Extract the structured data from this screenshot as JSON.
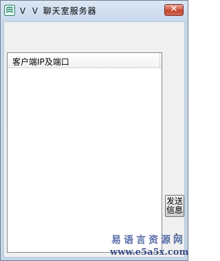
{
  "window": {
    "title": "Ｖ Ｖ 聊天室服务器",
    "close_glyph": "✕",
    "icon": "app-icon"
  },
  "list": {
    "columns": [
      "客户端IP及端口"
    ],
    "rows": []
  },
  "send_button": {
    "line1": "发送",
    "line2": "信息"
  },
  "watermark": {
    "line1": "易语言资源网",
    "line2": "www.e5a5x.com"
  },
  "colors": {
    "titlebar": "#c9d9ec",
    "close_button": "#c94a34",
    "client_background": "#f0f0f0",
    "watermark": "#5a6fa8"
  }
}
